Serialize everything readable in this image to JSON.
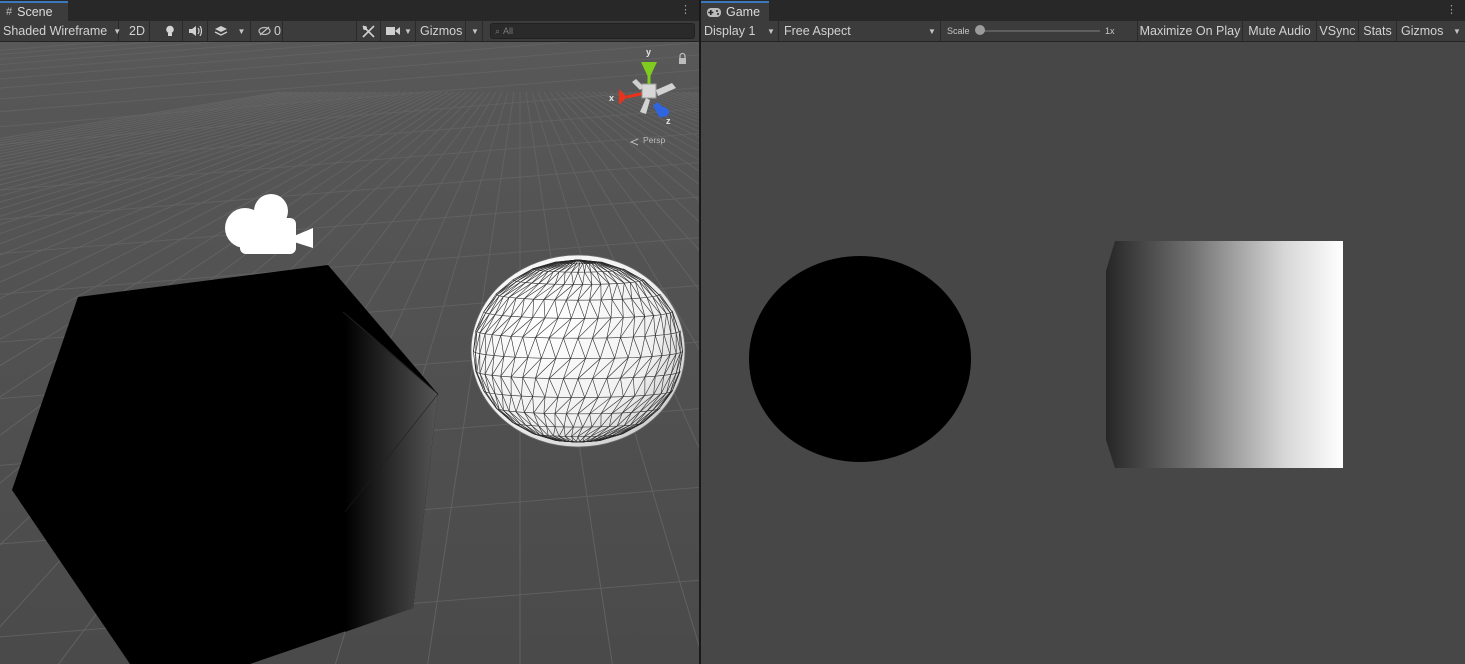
{
  "scene": {
    "tab_label": "Scene",
    "tab_icon": "grid-icon",
    "toolbar": {
      "draw_mode": "Shaded Wireframe",
      "mode_2d": "2D",
      "hidden_count": "0",
      "gizmos": "Gizmos",
      "search_placeholder": "All"
    },
    "orientation_gizmo": {
      "y": "y",
      "x": "x",
      "z": "z",
      "projection": "Persp"
    }
  },
  "game": {
    "tab_label": "Game",
    "tab_icon": "gamepad-icon",
    "toolbar": {
      "display": "Display 1",
      "aspect": "Free Aspect",
      "scale_label": "Scale",
      "scale_value": "1x",
      "scale_level": 1,
      "maximize_on_play": "Maximize On Play",
      "mute_audio": "Mute Audio",
      "vsync": "VSync",
      "stats": "Stats",
      "gizmos": "Gizmos"
    }
  },
  "colors": {
    "tab_accent": "#3a79bb",
    "panel_bg": "#474747",
    "toolbar_bg": "#3c3c3c",
    "gizmo_x": "#e8331a",
    "gizmo_y": "#7fcc1f",
    "gizmo_z": "#2f65e0"
  }
}
